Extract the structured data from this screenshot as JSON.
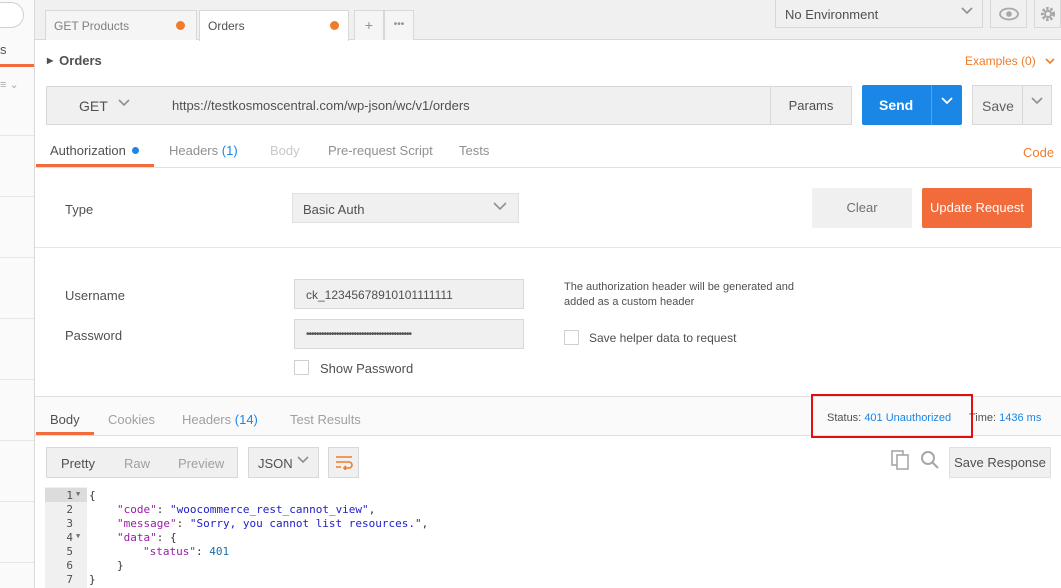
{
  "sidebar": {
    "tab_fragment": "s",
    "filter_glyph": "≡ ⌄"
  },
  "tabs": [
    {
      "label": "GET Products",
      "active": false
    },
    {
      "label": "Orders",
      "active": true
    }
  ],
  "tab_add": "+",
  "tab_more": "•••",
  "environment": {
    "selected": "No Environment"
  },
  "request": {
    "name": "Orders",
    "examples": "Examples (0)",
    "method": "GET",
    "url": "https://testkosmoscentral.com/wp-json/wc/v1/orders",
    "params_label": "Params",
    "send_label": "Send",
    "save_label": "Save"
  },
  "request_tabs": [
    {
      "label": "Authorization",
      "count": ""
    },
    {
      "label": "Headers",
      "count": "(1)"
    },
    {
      "label": "Body",
      "count": ""
    },
    {
      "label": "Pre-request Script",
      "count": ""
    },
    {
      "label": "Tests",
      "count": ""
    }
  ],
  "code_link": "Code",
  "auth": {
    "type_label": "Type",
    "type_value": "Basic Auth",
    "clear_label": "Clear",
    "update_label": "Update Request",
    "username_label": "Username",
    "username_value": "ck_12345678910101111111",
    "password_label": "Password",
    "password_value": "••••••••••••••••••••••••••••••••••••••••••",
    "show_password_label": "Show Password",
    "note": "The authorization header will be generated and added as a custom header",
    "save_helper_label": "Save helper data to request"
  },
  "response_tabs": [
    {
      "label": "Body",
      "count": ""
    },
    {
      "label": "Cookies",
      "count": ""
    },
    {
      "label": "Headers",
      "count": "(14)"
    },
    {
      "label": "Test Results",
      "count": ""
    }
  ],
  "response": {
    "status_label": "Status:",
    "status_value": "401 Unauthorized",
    "time_label": "Time:",
    "time_value": "1436 ms",
    "view_modes": [
      "Pretty",
      "Raw",
      "Preview"
    ],
    "format": "JSON",
    "save_response_label": "Save Response",
    "lines": [
      "1",
      "2",
      "3",
      "4",
      "5",
      "6",
      "7"
    ],
    "code": {
      "l1": "{",
      "k_code": "\"code\"",
      "v_code": "\"woocommerce_rest_cannot_view\"",
      "k_message": "\"message\"",
      "v_message": "\"Sorry, you cannot list resources.\"",
      "k_data": "\"data\"",
      "k_status": "\"status\"",
      "v_status": "401",
      "l6": "}",
      "l7": "}"
    }
  },
  "colors": {
    "accent": "#f26b3a",
    "primary": "#1a86e6",
    "highlight_box": "#e01010"
  }
}
